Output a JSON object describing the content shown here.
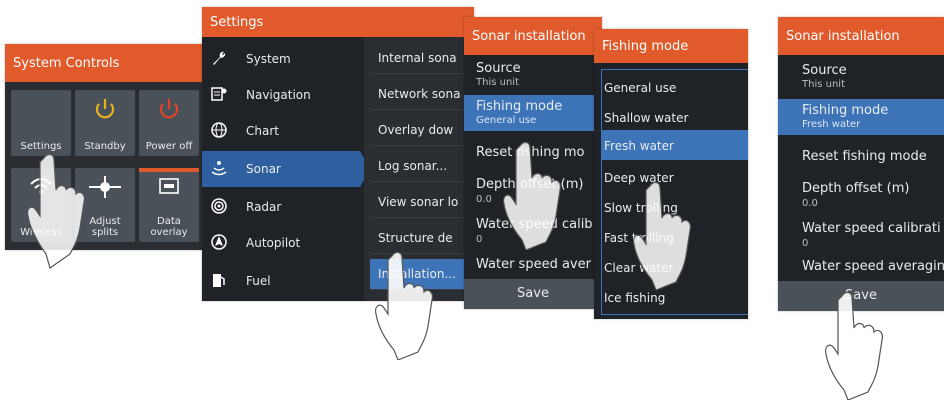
{
  "colors": {
    "accent_orange": "#e05a2b",
    "selected_blue": "#3d74b8",
    "panel_dark": "#1f2226",
    "tile_gray": "#4b5159",
    "power_red": "#e0442b",
    "standby_yellow": "#e6b21e"
  },
  "system_controls": {
    "title": "System Controls",
    "tiles": [
      {
        "label": "Settings",
        "icon": "gear-icon"
      },
      {
        "label": "Standby",
        "icon": "standby-icon"
      },
      {
        "label": "Power off",
        "icon": "power-icon"
      },
      {
        "label": "Wireless",
        "icon": "wireless-icon"
      },
      {
        "label": "Adjust splits",
        "icon": "adjust-splits-icon"
      },
      {
        "label": "Data overlay",
        "icon": "data-overlay-icon"
      }
    ]
  },
  "settings": {
    "title": "Settings",
    "sidebar": [
      {
        "label": "System",
        "icon": "wrench-icon"
      },
      {
        "label": "Navigation",
        "icon": "navigation-icon"
      },
      {
        "label": "Chart",
        "icon": "globe-icon"
      },
      {
        "label": "Sonar",
        "icon": "sonar-icon"
      },
      {
        "label": "Radar",
        "icon": "radar-icon"
      },
      {
        "label": "Autopilot",
        "icon": "autopilot-icon"
      },
      {
        "label": "Fuel",
        "icon": "fuel-icon"
      }
    ],
    "menu": [
      "Internal sona",
      "Network sona",
      "Overlay dow",
      "Log sonar...",
      "View sonar lo",
      "Structure de",
      "Installation..."
    ]
  },
  "sonar_installation_a": {
    "title": "Sonar installation",
    "rows": [
      {
        "label": "Source",
        "value": "This unit"
      },
      {
        "label": "Fishing mode",
        "value": "General use"
      },
      {
        "label": "Reset fishing mo",
        "value": ""
      },
      {
        "label": "Depth offset (m)",
        "value": "0.0"
      },
      {
        "label": "Water speed calib",
        "value": "0"
      },
      {
        "label": "Water speed aver",
        "value": ""
      }
    ],
    "save_label": "Save"
  },
  "fishing_mode": {
    "title": "Fishing mode",
    "options": [
      "General use",
      "Shallow water",
      "Fresh water",
      "Deep water",
      "Slow trolling",
      "Fast trolling",
      "Clear water",
      "Ice fishing"
    ]
  },
  "sonar_installation_b": {
    "title": "Sonar installation",
    "rows": [
      {
        "label": "Source",
        "value": "This unit"
      },
      {
        "label": "Fishing mode",
        "value": "Fresh water"
      },
      {
        "label": "Reset fishing mode",
        "value": ""
      },
      {
        "label": "Depth offset (m)",
        "value": "0.0"
      },
      {
        "label": "Water speed calibrati",
        "value": "0"
      },
      {
        "label": "Water speed averagin",
        "value": ""
      }
    ],
    "save_label": "Save"
  }
}
